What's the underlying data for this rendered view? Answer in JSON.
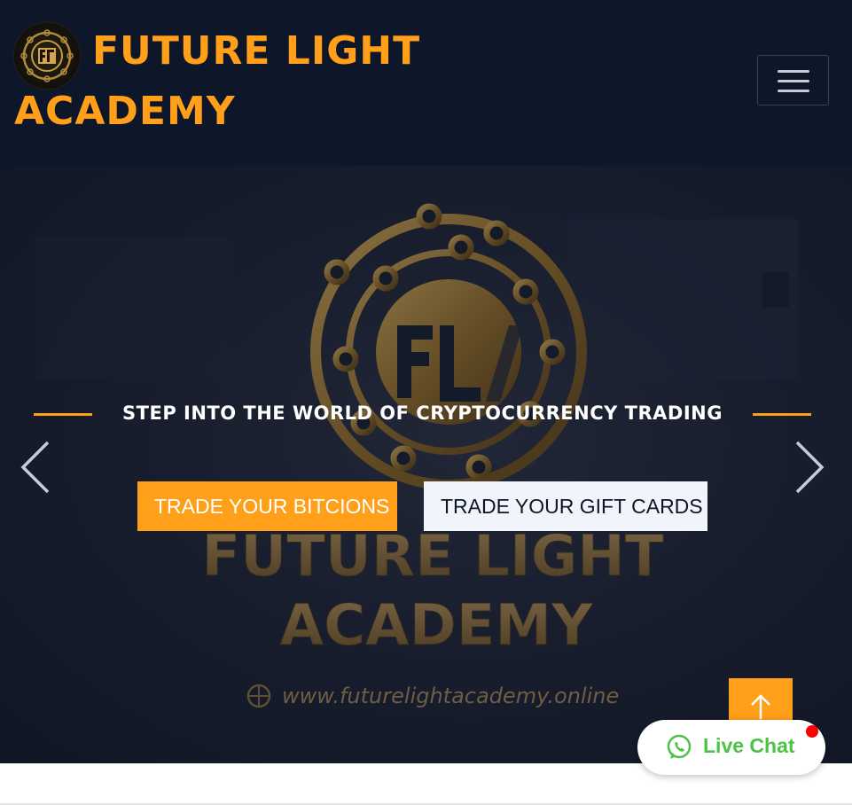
{
  "header": {
    "brand_line1": "FUTURE LIGHT",
    "brand_line2": "ACADEMY",
    "logo_icon": "future-light-academy-logo",
    "menu_icon": "hamburger-menu-icon"
  },
  "hero": {
    "tagline": "STEP INTO THE WORLD OF CRYPTOCURRENCY TRADING",
    "primary_button": "TRADE YOUR BITCIONS",
    "secondary_button": "TRADE YOUR GIFT CARDS",
    "background_sign_line1": "FUTURE LIGHT",
    "background_sign_line2": "ACADEMY",
    "background_sign_url": "www.futurelightacademy.online",
    "prev_icon": "chevron-left-icon",
    "next_icon": "chevron-right-icon"
  },
  "widgets": {
    "back_to_top_icon": "arrow-up-icon",
    "live_chat_label": "Live Chat",
    "live_chat_icon": "whatsapp-icon"
  },
  "colors": {
    "accent": "#ff9f1a",
    "navbar": "#0e1629",
    "whatsapp": "#4dc247",
    "notification": "#ff0000"
  }
}
